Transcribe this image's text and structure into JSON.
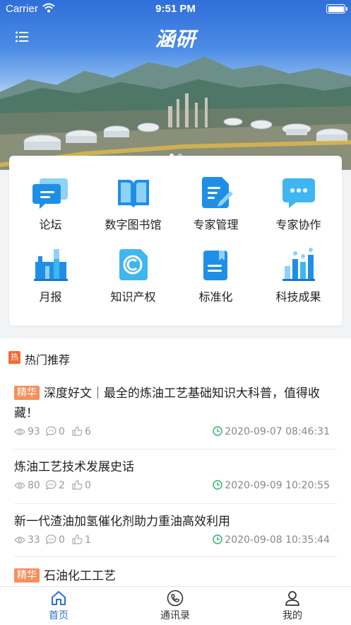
{
  "status_bar": {
    "carrier": "Carrier",
    "time": "9:51 PM"
  },
  "header": {
    "title": "涵研",
    "menu_icon": "menu-icon"
  },
  "banner": {
    "slide_count": 2,
    "active_slide": 1
  },
  "grid": [
    {
      "label": "论坛",
      "icon": "forum-chat-icon"
    },
    {
      "label": "数字图书馆",
      "icon": "book-icon"
    },
    {
      "label": "专家管理",
      "icon": "document-edit-icon"
    },
    {
      "label": "专家协作",
      "icon": "message-dots-icon"
    },
    {
      "label": "月报",
      "icon": "factory-icon"
    },
    {
      "label": "知识产权",
      "icon": "copyright-icon"
    },
    {
      "label": "标准化",
      "icon": "standard-document-icon"
    },
    {
      "label": "科技成果",
      "icon": "achievement-chart-icon"
    }
  ],
  "hot": {
    "badge": "热",
    "title": "热门推荐",
    "articles": [
      {
        "tag": "精华",
        "title": "深度好文｜最全的炼油工艺基础知识大科普，值得收藏！",
        "views": "93",
        "comments": "0",
        "likes": "6",
        "time": "2020-09-07 08:46:31"
      },
      {
        "tag": "",
        "title": "炼油工艺技术发展史话",
        "views": "80",
        "comments": "2",
        "likes": "0",
        "time": "2020-09-09 10:20:55"
      },
      {
        "tag": "",
        "title": "新一代渣油加氢催化剂助力重油高效利用",
        "views": "33",
        "comments": "0",
        "likes": "1",
        "time": "2020-09-08 10:35:44"
      },
      {
        "tag": "精华",
        "title": "石油化工工艺"
      }
    ]
  },
  "tabbar": [
    {
      "label": "首页",
      "icon": "home-icon",
      "active": true
    },
    {
      "label": "通讯录",
      "icon": "phone-icon",
      "active": false
    },
    {
      "label": "我的",
      "icon": "user-icon",
      "active": false
    }
  ],
  "colors": {
    "accent": "#2c6fd7",
    "tag": "#f5905b",
    "hot_badge": "#f06a35",
    "time_icon": "#2fb36b"
  }
}
